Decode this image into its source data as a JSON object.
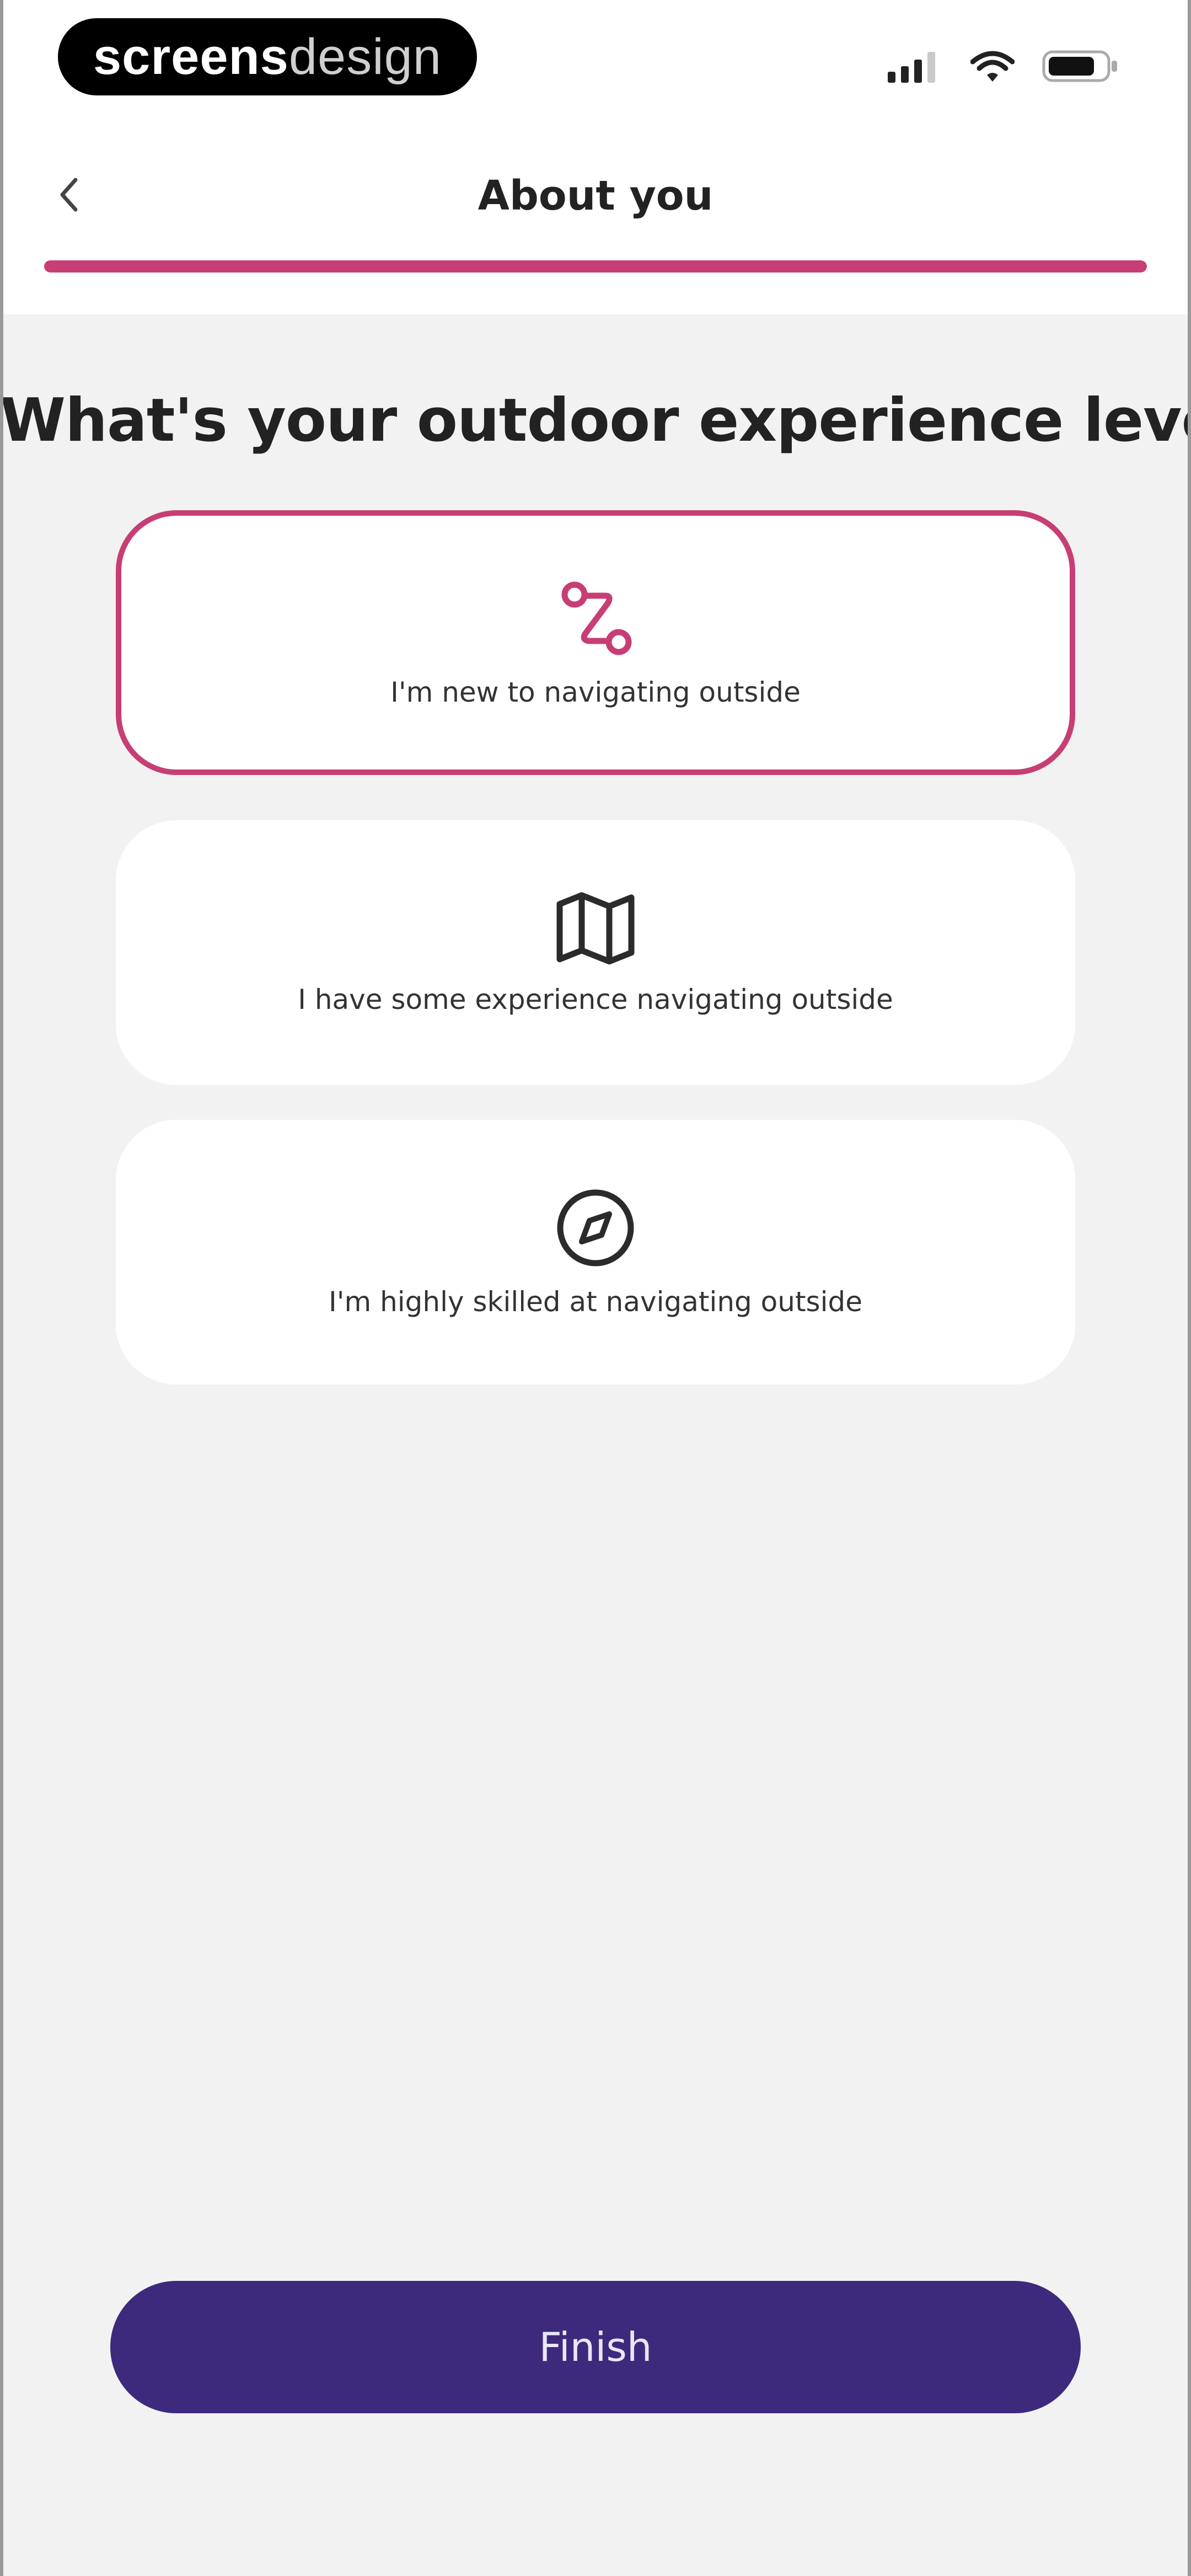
{
  "brand": {
    "watermark_bold": "screens",
    "watermark_thin": "design"
  },
  "header": {
    "title": "About you",
    "progress": 1.0
  },
  "question": "What's your outdoor experience level?",
  "options": [
    {
      "label": "I'm new to navigating outside",
      "icon": "route-icon",
      "selected": true
    },
    {
      "label": "I have some experience navigating outside",
      "icon": "map-icon",
      "selected": false
    },
    {
      "label": "I'm highly skilled at navigating outside",
      "icon": "compass-icon",
      "selected": false
    }
  ],
  "finish_label": "Finish",
  "colors": {
    "accent": "#c73e75",
    "primary_button": "#3d2a7d",
    "background": "#f2f2f2"
  }
}
